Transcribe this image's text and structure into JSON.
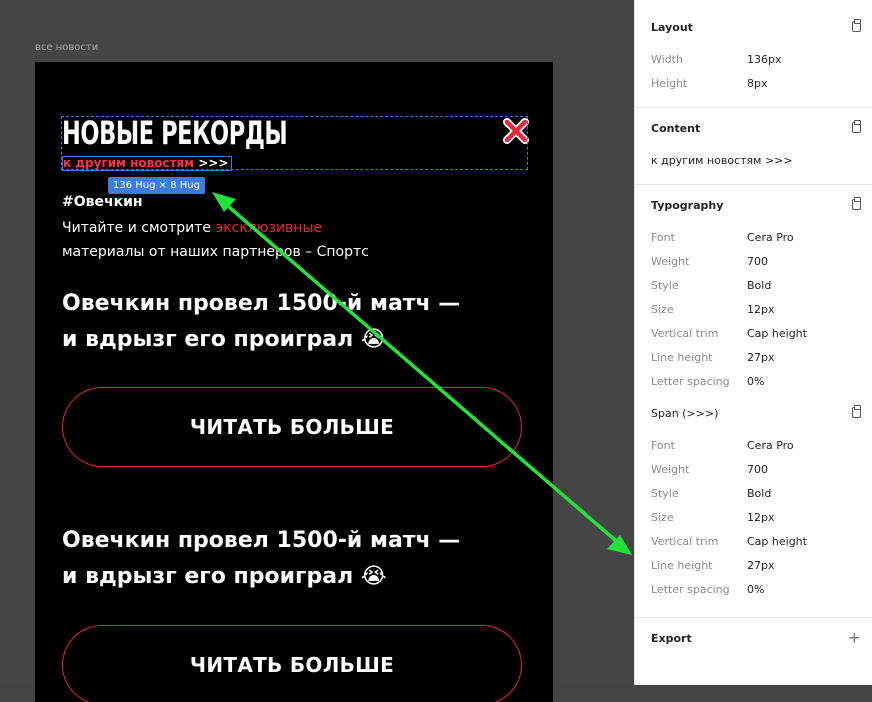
{
  "canvas": {
    "frame_label": "все новости",
    "headline": "НОВЫЕ РЕКОРДЫ",
    "link_text": "к другим новостям",
    "link_arrows": ">>>",
    "size_badge": "136 Hug × 8 Hug",
    "hashtag": "#Овечкин",
    "intro_before": "Читайте и смотрите ",
    "intro_accent": "эксклюзивные",
    "intro_after": " материалы от наших партнеров – Спортс",
    "news": [
      {
        "title": "Овечкин провел 1500-й матч — и вдрызг его проиграл 😭",
        "button": "ЧИТАТЬ БОЛЬШЕ"
      },
      {
        "title": "Овечкин провел 1500-й матч — и вдрызг его проиграл 😭",
        "button": "ЧИТАТЬ БОЛЬШЕ"
      }
    ]
  },
  "panel": {
    "layout": {
      "title": "Layout",
      "width_label": "Width",
      "width_value": "136px",
      "height_label": "Height",
      "height_value": "8px"
    },
    "content": {
      "title": "Content",
      "text": "к другим новостям >>>"
    },
    "typography": {
      "title": "Typography",
      "rows": [
        {
          "label": "Font",
          "value": "Cera Pro"
        },
        {
          "label": "Weight",
          "value": "700"
        },
        {
          "label": "Style",
          "value": "Bold"
        },
        {
          "label": "Size",
          "value": "12px"
        },
        {
          "label": "Vertical trim",
          "value": "Cap height"
        },
        {
          "label": "Line height",
          "value": "27px"
        },
        {
          "label": "Letter spacing",
          "value": "0%"
        }
      ]
    },
    "span": {
      "title": "Span (>>>)",
      "rows": [
        {
          "label": "Font",
          "value": "Cera Pro"
        },
        {
          "label": "Weight",
          "value": "700"
        },
        {
          "label": "Style",
          "value": "Bold"
        },
        {
          "label": "Size",
          "value": "12px"
        },
        {
          "label": "Vertical trim",
          "value": "Cap height"
        },
        {
          "label": "Line height",
          "value": "27px"
        },
        {
          "label": "Letter spacing",
          "value": "0%"
        }
      ]
    },
    "export": {
      "title": "Export"
    }
  },
  "colors": {
    "accent_red": "#e8263c",
    "selection_blue": "#3d7be0",
    "arrow_green": "#22e33a"
  }
}
